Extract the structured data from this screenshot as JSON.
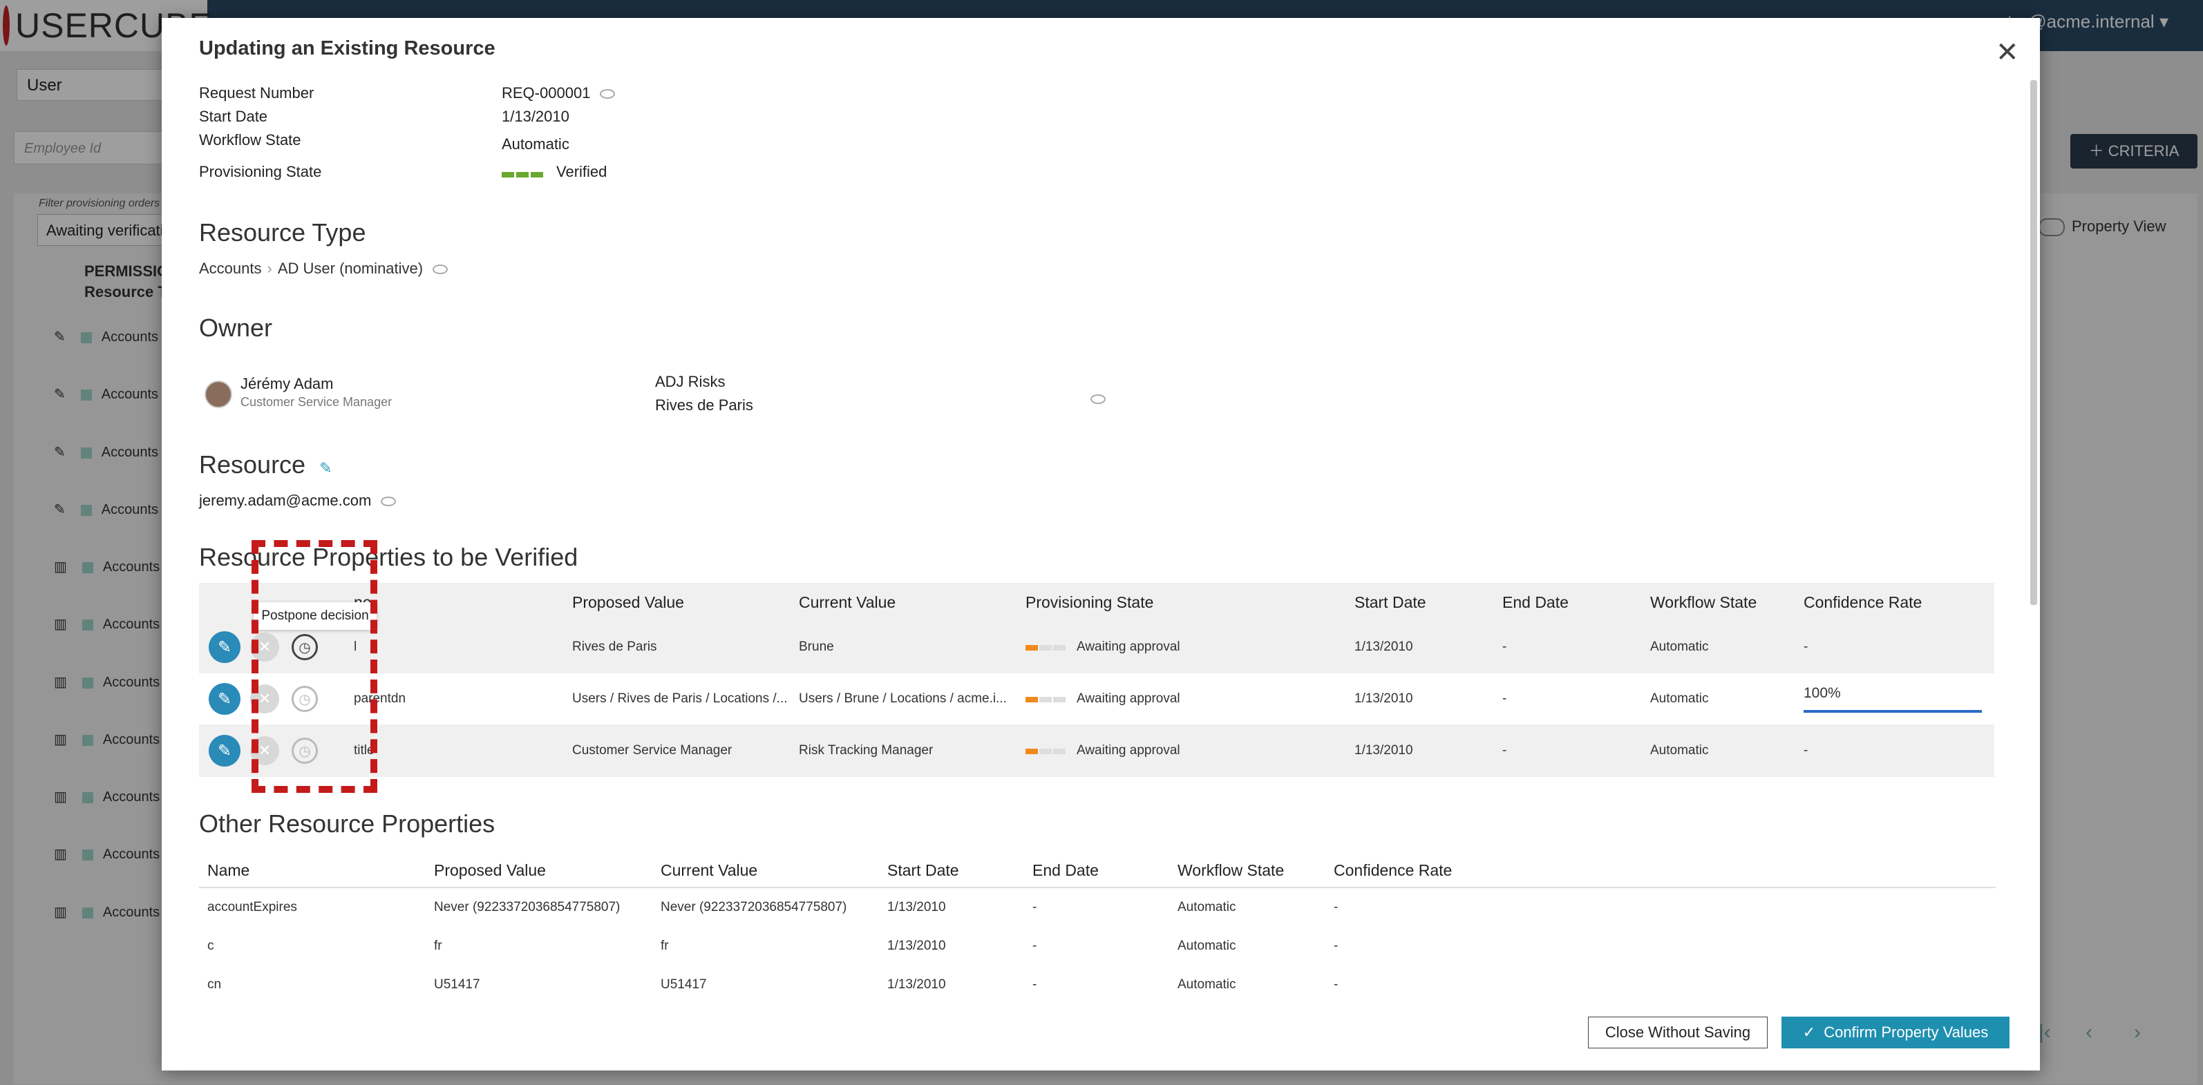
{
  "app": {
    "logo_text": "USERCUBE",
    "user_email": "tor@acme.internal"
  },
  "background": {
    "entity_select": "User",
    "search_placeholder": "Employee Id",
    "filter_label": "Filter provisioning orders",
    "filter_value": "Awaiting verificatio",
    "column_header_1": "PERMISSIO",
    "column_header_2": "Resource Ty",
    "row_label": "Accounts",
    "criteria_label": "CRITERIA",
    "property_view_label": "Property View"
  },
  "modal": {
    "title": "Updating an Existing Resource",
    "close_icon": "close-icon",
    "request_number_label": "Request Number",
    "request_number": "REQ-000001",
    "start_date_label": "Start Date",
    "start_date": "1/13/2010",
    "workflow_state_label": "Workflow State",
    "workflow_state": "Automatic",
    "provisioning_state_label": "Provisioning State",
    "provisioning_state": "Verified",
    "verified_color": "#6aa82f",
    "resource_type_heading": "Resource Type",
    "resource_type_crumb_1": "Accounts",
    "resource_type_crumb_2": "AD User (nominative)",
    "owner_heading": "Owner",
    "owner_name": "Jérémy Adam",
    "owner_role": "Customer Service Manager",
    "owner_org_1": "ADJ Risks",
    "owner_org_2": "Rives de Paris",
    "resource_heading": "Resource",
    "resource_value": "jeremy.adam@acme.com",
    "verify_heading": "Resource Properties to be Verified",
    "tooltip": "Postpone decision",
    "close_without_saving": "Close Without Saving",
    "confirm_property_values": "Confirm Property Values",
    "accent_color": "#1f8fb0"
  },
  "verify_table": {
    "headers": {
      "name": "ne",
      "proposed": "Proposed Value",
      "current": "Current Value",
      "prov": "Provisioning State",
      "start": "Start Date",
      "end": "End Date",
      "workflow": "Workflow State",
      "confidence": "Confidence Rate"
    },
    "rows": [
      {
        "name": "l",
        "proposed": "Rives de Paris",
        "current": "Brune",
        "prov": "Awaiting approval",
        "start": "1/13/2010",
        "end": "-",
        "workflow": "Automatic",
        "confidence": "-"
      },
      {
        "name": "parentdn",
        "proposed": "Users / Rives de Paris / Locations /...",
        "current": "Users / Brune / Locations / acme.i...",
        "prov": "Awaiting approval",
        "start": "1/13/2010",
        "end": "-",
        "workflow": "Automatic",
        "confidence": "100%"
      },
      {
        "name": "title",
        "proposed": "Customer Service Manager",
        "current": "Risk Tracking Manager",
        "prov": "Awaiting approval",
        "start": "1/13/2010",
        "end": "-",
        "workflow": "Automatic",
        "confidence": "-"
      }
    ]
  },
  "other_table": {
    "heading": "Other Resource Properties",
    "headers": {
      "name": "Name",
      "proposed": "Proposed Value",
      "current": "Current Value",
      "start": "Start Date",
      "end": "End Date",
      "workflow": "Workflow State",
      "confidence": "Confidence Rate"
    },
    "rows": [
      {
        "name": "accountExpires",
        "proposed": "Never (9223372036854775807)",
        "current": "Never (9223372036854775807)",
        "start": "1/13/2010",
        "end": "-",
        "workflow": "Automatic",
        "confidence": "-"
      },
      {
        "name": "c",
        "proposed": "fr",
        "current": "fr",
        "start": "1/13/2010",
        "end": "-",
        "workflow": "Automatic",
        "confidence": "-"
      },
      {
        "name": "cn",
        "proposed": "U51417",
        "current": "U51417",
        "start": "1/13/2010",
        "end": "-",
        "workflow": "Automatic",
        "confidence": "-"
      }
    ]
  }
}
